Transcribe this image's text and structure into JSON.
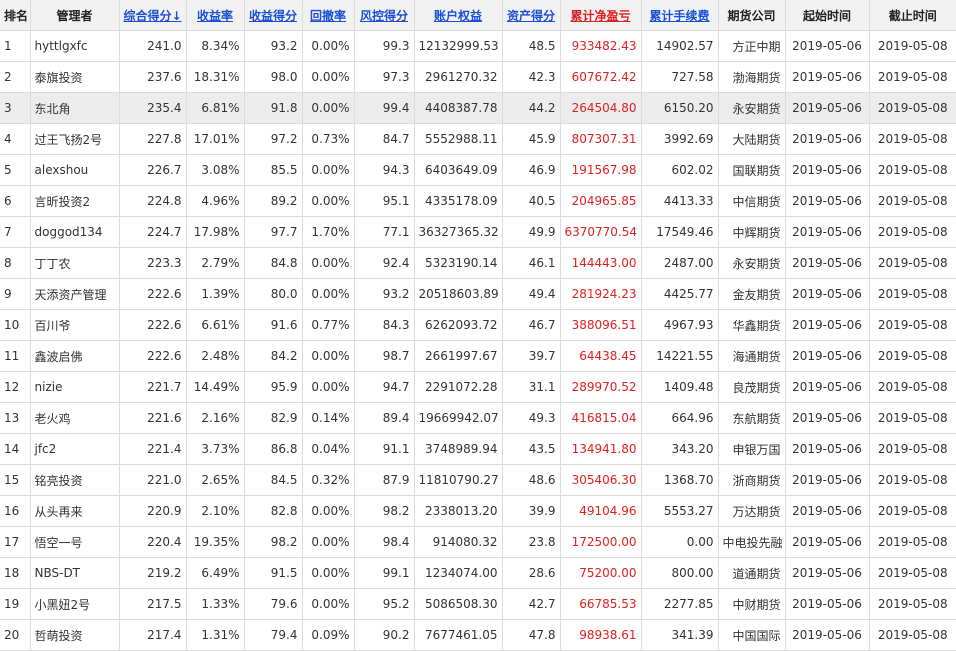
{
  "header": {
    "rank": "排名",
    "manager": "管理者",
    "composite": "综合得分",
    "sort_arrow": "↓",
    "return_rate": "收益率",
    "return_score": "收益得分",
    "drawdown": "回撤率",
    "risk_score": "风控得分",
    "equity": "账户权益",
    "asset_score": "资产得分",
    "net_pnl": "累计净盈亏",
    "fees": "累计手续费",
    "company": "期货公司",
    "start": "起始时间",
    "end": "截止时间"
  },
  "rows": [
    {
      "rank": "1",
      "manager": "hyttlgxfc",
      "composite": "241.0",
      "return_rate": "8.34%",
      "return_score": "93.2",
      "drawdown": "0.00%",
      "risk_score": "99.3",
      "equity": "12132999.53",
      "asset_score": "48.5",
      "net_pnl": "933482.43",
      "fees": "14902.57",
      "company": "方正中期",
      "start": "2019-05-06",
      "end": "2019-05-08"
    },
    {
      "rank": "2",
      "manager": "泰旗投资",
      "composite": "237.6",
      "return_rate": "18.31%",
      "return_score": "98.0",
      "drawdown": "0.00%",
      "risk_score": "97.3",
      "equity": "2961270.32",
      "asset_score": "42.3",
      "net_pnl": "607672.42",
      "fees": "727.58",
      "company": "渤海期货",
      "start": "2019-05-06",
      "end": "2019-05-08"
    },
    {
      "rank": "3",
      "manager": "东北角",
      "composite": "235.4",
      "return_rate": "6.81%",
      "return_score": "91.8",
      "drawdown": "0.00%",
      "risk_score": "99.4",
      "equity": "4408387.78",
      "asset_score": "44.2",
      "net_pnl": "264504.80",
      "fees": "6150.20",
      "company": "永安期货",
      "start": "2019-05-06",
      "end": "2019-05-08"
    },
    {
      "rank": "4",
      "manager": "过王飞扬2号",
      "composite": "227.8",
      "return_rate": "17.01%",
      "return_score": "97.2",
      "drawdown": "0.73%",
      "risk_score": "84.7",
      "equity": "5552988.11",
      "asset_score": "45.9",
      "net_pnl": "807307.31",
      "fees": "3992.69",
      "company": "大陆期货",
      "start": "2019-05-06",
      "end": "2019-05-08"
    },
    {
      "rank": "5",
      "manager": "alexshou",
      "composite": "226.7",
      "return_rate": "3.08%",
      "return_score": "85.5",
      "drawdown": "0.00%",
      "risk_score": "94.3",
      "equity": "6403649.09",
      "asset_score": "46.9",
      "net_pnl": "191567.98",
      "fees": "602.02",
      "company": "国联期货",
      "start": "2019-05-06",
      "end": "2019-05-08"
    },
    {
      "rank": "6",
      "manager": "言昕投资2",
      "composite": "224.8",
      "return_rate": "4.96%",
      "return_score": "89.2",
      "drawdown": "0.00%",
      "risk_score": "95.1",
      "equity": "4335178.09",
      "asset_score": "40.5",
      "net_pnl": "204965.85",
      "fees": "4413.33",
      "company": "中信期货",
      "start": "2019-05-06",
      "end": "2019-05-08"
    },
    {
      "rank": "7",
      "manager": "doggod134",
      "composite": "224.7",
      "return_rate": "17.98%",
      "return_score": "97.7",
      "drawdown": "1.70%",
      "risk_score": "77.1",
      "equity": "36327365.32",
      "asset_score": "49.9",
      "net_pnl": "6370770.54",
      "fees": "17549.46",
      "company": "中辉期货",
      "start": "2019-05-06",
      "end": "2019-05-08"
    },
    {
      "rank": "8",
      "manager": "丁丁农",
      "composite": "223.3",
      "return_rate": "2.79%",
      "return_score": "84.8",
      "drawdown": "0.00%",
      "risk_score": "92.4",
      "equity": "5323190.14",
      "asset_score": "46.1",
      "net_pnl": "144443.00",
      "fees": "2487.00",
      "company": "永安期货",
      "start": "2019-05-06",
      "end": "2019-05-08"
    },
    {
      "rank": "9",
      "manager": "天添资产管理",
      "composite": "222.6",
      "return_rate": "1.39%",
      "return_score": "80.0",
      "drawdown": "0.00%",
      "risk_score": "93.2",
      "equity": "20518603.89",
      "asset_score": "49.4",
      "net_pnl": "281924.23",
      "fees": "4425.77",
      "company": "金友期货",
      "start": "2019-05-06",
      "end": "2019-05-08"
    },
    {
      "rank": "10",
      "manager": "百川爷",
      "composite": "222.6",
      "return_rate": "6.61%",
      "return_score": "91.6",
      "drawdown": "0.77%",
      "risk_score": "84.3",
      "equity": "6262093.72",
      "asset_score": "46.7",
      "net_pnl": "388096.51",
      "fees": "4967.93",
      "company": "华鑫期货",
      "start": "2019-05-06",
      "end": "2019-05-08"
    },
    {
      "rank": "11",
      "manager": "鑫波启佛",
      "composite": "222.6",
      "return_rate": "2.48%",
      "return_score": "84.2",
      "drawdown": "0.00%",
      "risk_score": "98.7",
      "equity": "2661997.67",
      "asset_score": "39.7",
      "net_pnl": "64438.45",
      "fees": "14221.55",
      "company": "海通期货",
      "start": "2019-05-06",
      "end": "2019-05-08"
    },
    {
      "rank": "12",
      "manager": "nizie",
      "composite": "221.7",
      "return_rate": "14.49%",
      "return_score": "95.9",
      "drawdown": "0.00%",
      "risk_score": "94.7",
      "equity": "2291072.28",
      "asset_score": "31.1",
      "net_pnl": "289970.52",
      "fees": "1409.48",
      "company": "良茂期货",
      "start": "2019-05-06",
      "end": "2019-05-08"
    },
    {
      "rank": "13",
      "manager": "老火鸡",
      "composite": "221.6",
      "return_rate": "2.16%",
      "return_score": "82.9",
      "drawdown": "0.14%",
      "risk_score": "89.4",
      "equity": "19669942.07",
      "asset_score": "49.3",
      "net_pnl": "416815.04",
      "fees": "664.96",
      "company": "东航期货",
      "start": "2019-05-06",
      "end": "2019-05-08"
    },
    {
      "rank": "14",
      "manager": "jfc2",
      "composite": "221.4",
      "return_rate": "3.73%",
      "return_score": "86.8",
      "drawdown": "0.04%",
      "risk_score": "91.1",
      "equity": "3748989.94",
      "asset_score": "43.5",
      "net_pnl": "134941.80",
      "fees": "343.20",
      "company": "申银万国",
      "start": "2019-05-06",
      "end": "2019-05-08"
    },
    {
      "rank": "15",
      "manager": "铭亮投资",
      "composite": "221.0",
      "return_rate": "2.65%",
      "return_score": "84.5",
      "drawdown": "0.32%",
      "risk_score": "87.9",
      "equity": "11810790.27",
      "asset_score": "48.6",
      "net_pnl": "305406.30",
      "fees": "1368.70",
      "company": "浙商期货",
      "start": "2019-05-06",
      "end": "2019-05-08"
    },
    {
      "rank": "16",
      "manager": "从头再来",
      "composite": "220.9",
      "return_rate": "2.10%",
      "return_score": "82.8",
      "drawdown": "0.00%",
      "risk_score": "98.2",
      "equity": "2338013.20",
      "asset_score": "39.9",
      "net_pnl": "49104.96",
      "fees": "5553.27",
      "company": "万达期货",
      "start": "2019-05-06",
      "end": "2019-05-08"
    },
    {
      "rank": "17",
      "manager": "悟空一号",
      "composite": "220.4",
      "return_rate": "19.35%",
      "return_score": "98.2",
      "drawdown": "0.00%",
      "risk_score": "98.4",
      "equity": "914080.32",
      "asset_score": "23.8",
      "net_pnl": "172500.00",
      "fees": "0.00",
      "company": "中电投先融",
      "start": "2019-05-06",
      "end": "2019-05-08"
    },
    {
      "rank": "18",
      "manager": "NBS-DT",
      "composite": "219.2",
      "return_rate": "6.49%",
      "return_score": "91.5",
      "drawdown": "0.00%",
      "risk_score": "99.1",
      "equity": "1234074.00",
      "asset_score": "28.6",
      "net_pnl": "75200.00",
      "fees": "800.00",
      "company": "道通期货",
      "start": "2019-05-06",
      "end": "2019-05-08"
    },
    {
      "rank": "19",
      "manager": "小黑妞2号",
      "composite": "217.5",
      "return_rate": "1.33%",
      "return_score": "79.6",
      "drawdown": "0.00%",
      "risk_score": "95.2",
      "equity": "5086508.30",
      "asset_score": "42.7",
      "net_pnl": "66785.53",
      "fees": "2277.85",
      "company": "中财期货",
      "start": "2019-05-06",
      "end": "2019-05-08"
    },
    {
      "rank": "20",
      "manager": "哲萌投资",
      "composite": "217.4",
      "return_rate": "1.31%",
      "return_score": "79.4",
      "drawdown": "0.09%",
      "risk_score": "90.2",
      "equity": "7677461.05",
      "asset_score": "47.8",
      "net_pnl": "98938.61",
      "fees": "341.39",
      "company": "中国国际",
      "start": "2019-05-06",
      "end": "2019-05-08"
    }
  ],
  "highlighted_row_index": 2,
  "colors": {
    "link_blue": "#1a4fd6",
    "pnl_red": "#e02020",
    "header_bg": "#f2f2f2",
    "highlight_bg": "#ececec"
  }
}
